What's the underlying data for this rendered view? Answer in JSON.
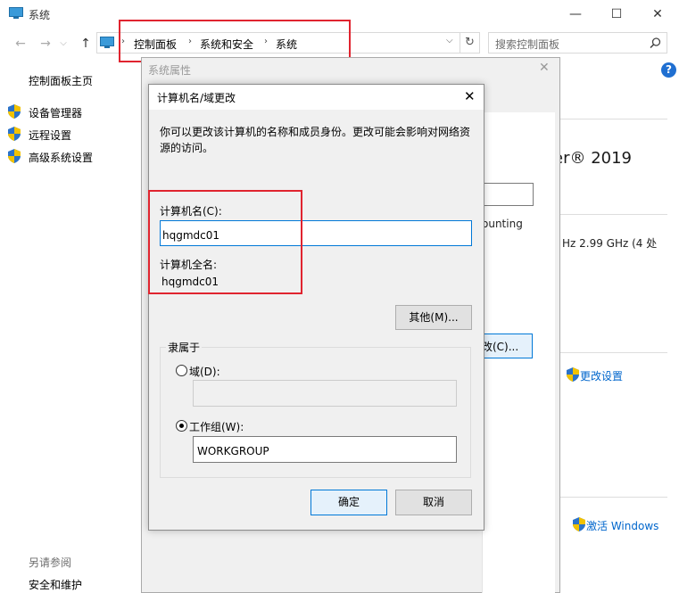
{
  "window": {
    "title": "系统",
    "minimize_glyph": "—",
    "maximize_glyph": "☐",
    "close_glyph": "✕"
  },
  "nav": {
    "back_glyph": "←",
    "forward_glyph": "→",
    "up_glyph": "↑",
    "breadcrumb": [
      "控制面板",
      "系统和安全",
      "系统"
    ],
    "separator": "›",
    "dropdown_glyph": "⌵",
    "refresh_glyph": "↻",
    "search_placeholder": "搜索控制面板"
  },
  "sidebar": {
    "home": "控制面板主页",
    "items": [
      {
        "label": "设备管理器",
        "icon": "shield-icon"
      },
      {
        "label": "远程设置",
        "icon": "shield-icon"
      },
      {
        "label": "高级系统设置",
        "icon": "shield-icon"
      }
    ],
    "see_also_heading": "另请参阅",
    "see_also_items": [
      "安全和维护"
    ]
  },
  "main": {
    "help_glyph": "?",
    "os_name_fragment": "er® 2019",
    "cpu_fragment": "Hz   2.99 GHz  (4 处",
    "change_settings": "更改设置",
    "activate_windows": "激活 Windows"
  },
  "system_properties": {
    "title": "系统属性",
    "close_glyph": "✕",
    "counting_fragment": "ounting",
    "change_button_fragment": "改(C)..."
  },
  "dialog": {
    "title": "计算机名/域更改",
    "close_glyph": "✕",
    "description": "你可以更改该计算机的名称和成员身份。更改可能会影响对网络资源的访问。",
    "computer_name_label": "计算机名(C):",
    "computer_name_value": "hqgmdc01",
    "full_name_label": "计算机全名:",
    "full_name_value": "hqgmdc01",
    "more_button": "其他(M)...",
    "member_of": {
      "group_label": "隶属于",
      "domain_label": "域(D):",
      "domain_value": "",
      "workgroup_label": "工作组(W):",
      "workgroup_value": "WORKGROUP",
      "selected": "workgroup"
    },
    "ok_button": "确定",
    "cancel_button": "取消"
  },
  "colors": {
    "highlight_box": "#e0242f",
    "link": "#0066cc",
    "accent": "#0078d7"
  }
}
